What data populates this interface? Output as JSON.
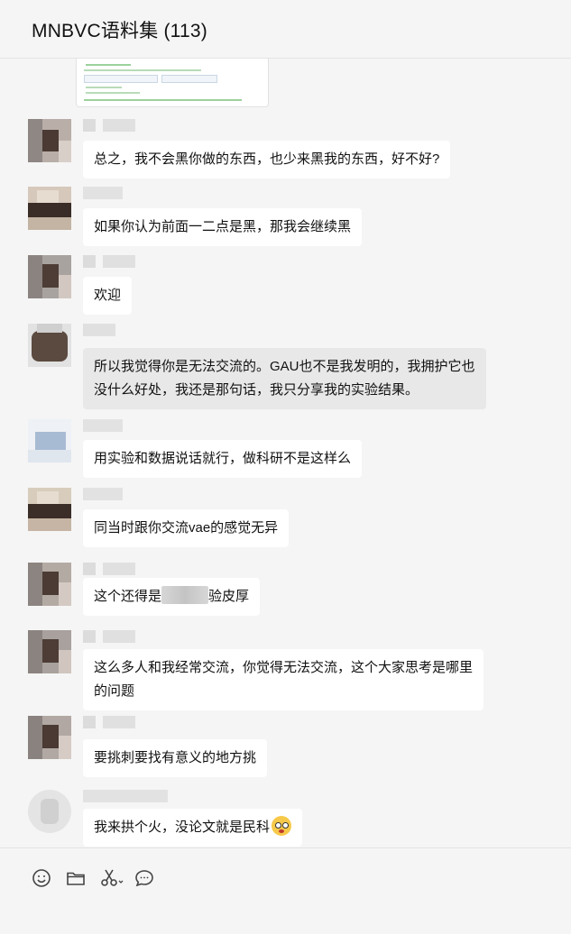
{
  "window": {
    "title": "MNBVC语料集 (113)"
  },
  "messages": [
    {
      "text": "总之，我不会黑你做的东西，也少来黑我的东西，好不好?"
    },
    {
      "text": "如果你认为前面一二点是黑，那我会继续黑"
    },
    {
      "text": "欢迎"
    },
    {
      "line1": "所以我觉得你是无法交流的。GAU也不是我发明的，我拥护它也",
      "line2": "没什么好处，我还是那句话，我只分享我的实验结果。"
    },
    {
      "text": "用实验和数据说话就行，做科研不是这样么"
    },
    {
      "text": "同当时跟你交流vae的感觉无异"
    },
    {
      "before": "这个还得是",
      "after": "验皮厚"
    },
    {
      "line1": "这么多人和我经常交流，你觉得无法交流，这个大家思考是哪里",
      "line2": "的问题"
    },
    {
      "text": "要挑刺要找有意义的地方挑"
    },
    {
      "text": "我来拱个火，没论文就是民科"
    }
  ],
  "toolbar": {
    "icons": [
      "emoji-icon",
      "folder-icon",
      "scissors-icon",
      "chat-bubble-icon"
    ]
  }
}
